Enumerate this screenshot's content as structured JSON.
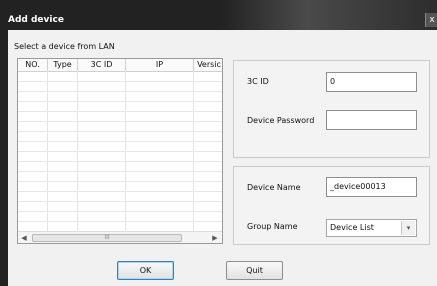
{
  "dialog": {
    "title": "Add device",
    "close_glyph": "x"
  },
  "lan": {
    "label": "Select a device from LAN",
    "columns": [
      "NO.",
      "Type",
      "3C ID",
      "IP",
      "Versic"
    ],
    "scroll_left": "◀",
    "scroll_right": "▶",
    "scroll_grip": "III"
  },
  "form": {
    "id_label": "3C ID",
    "id_value": "0",
    "password_label": "Device Password",
    "password_value": "",
    "name_label": "Device Name",
    "name_value": "_device00013",
    "group_label": "Group Name",
    "group_value": "Device List",
    "group_dropdown_glyph": "▾"
  },
  "buttons": {
    "ok_label": "OK",
    "quit_label": "Quit"
  }
}
